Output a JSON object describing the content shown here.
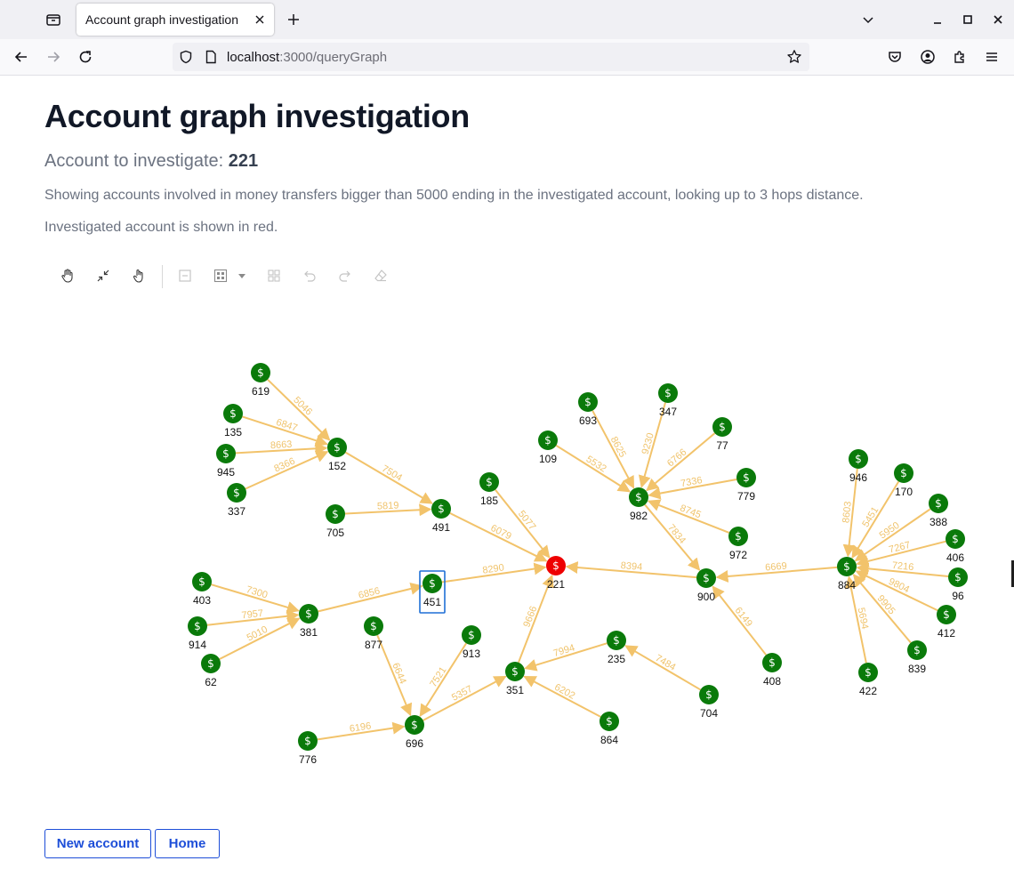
{
  "browser": {
    "tab_title": "Account graph investigation",
    "url_host": "localhost",
    "url_rest": ":3000/queryGraph"
  },
  "page": {
    "title": "Account graph investigation",
    "investigate_label": "Account to investigate:",
    "account_id": "221",
    "description": "Showing accounts involved in money transfers bigger than 5000 ending in the investigated account, looking up to 3 hops distance.",
    "note": "Investigated account is shown in red."
  },
  "toolbar": {
    "icons": [
      "pan-hand-icon",
      "collapse-icon",
      "pointer-hand-icon",
      "minus-box-icon",
      "grid-layout-icon",
      "dropdown-caret-icon",
      "tiles-icon",
      "undo-icon",
      "redo-icon",
      "eraser-icon"
    ]
  },
  "graph": {
    "node_symbol": "$",
    "colors": {
      "node": "#0a7a0a",
      "investigated": "#ee0000",
      "edge": "#f2c36b",
      "edge_label": "#f0c46e",
      "selection": "#1f6fd6"
    },
    "investigated_id": "221",
    "selected_id": "451",
    "nodes": [
      {
        "id": "619"
      },
      {
        "id": "135"
      },
      {
        "id": "945"
      },
      {
        "id": "337"
      },
      {
        "id": "152"
      },
      {
        "id": "705"
      },
      {
        "id": "491"
      },
      {
        "id": "185"
      },
      {
        "id": "221"
      },
      {
        "id": "451"
      },
      {
        "id": "403"
      },
      {
        "id": "914"
      },
      {
        "id": "62"
      },
      {
        "id": "381"
      },
      {
        "id": "877"
      },
      {
        "id": "913"
      },
      {
        "id": "696"
      },
      {
        "id": "776"
      },
      {
        "id": "351"
      },
      {
        "id": "235"
      },
      {
        "id": "864"
      },
      {
        "id": "704"
      },
      {
        "id": "900"
      },
      {
        "id": "408"
      },
      {
        "id": "693"
      },
      {
        "id": "347"
      },
      {
        "id": "109"
      },
      {
        "id": "77"
      },
      {
        "id": "982"
      },
      {
        "id": "779"
      },
      {
        "id": "972"
      },
      {
        "id": "884"
      },
      {
        "id": "946"
      },
      {
        "id": "170"
      },
      {
        "id": "388"
      },
      {
        "id": "406"
      },
      {
        "id": "96"
      },
      {
        "id": "412"
      },
      {
        "id": "839"
      },
      {
        "id": "422"
      }
    ],
    "edges": [
      {
        "from": "619",
        "to": "152",
        "amount": "5046"
      },
      {
        "from": "135",
        "to": "152",
        "amount": "6847"
      },
      {
        "from": "945",
        "to": "152",
        "amount": "8663"
      },
      {
        "from": "337",
        "to": "152",
        "amount": "8366"
      },
      {
        "from": "152",
        "to": "491",
        "amount": "7504"
      },
      {
        "from": "705",
        "to": "491",
        "amount": "5819"
      },
      {
        "from": "491",
        "to": "221",
        "amount": "6079"
      },
      {
        "from": "185",
        "to": "221",
        "amount": "5077"
      },
      {
        "from": "451",
        "to": "221",
        "amount": "8290"
      },
      {
        "from": "900",
        "to": "221",
        "amount": "8394"
      },
      {
        "from": "351",
        "to": "221",
        "amount": "9666"
      },
      {
        "from": "381",
        "to": "451",
        "amount": "6856"
      },
      {
        "from": "403",
        "to": "381",
        "amount": "7300"
      },
      {
        "from": "914",
        "to": "381",
        "amount": "7957"
      },
      {
        "from": "62",
        "to": "381",
        "amount": "5010"
      },
      {
        "from": "877",
        "to": "696",
        "amount": "6644"
      },
      {
        "from": "913",
        "to": "696",
        "amount": "7521"
      },
      {
        "from": "776",
        "to": "696",
        "amount": "6196"
      },
      {
        "from": "696",
        "to": "351",
        "amount": "5357"
      },
      {
        "from": "235",
        "to": "351",
        "amount": "7994"
      },
      {
        "from": "864",
        "to": "351",
        "amount": "6202"
      },
      {
        "from": "704",
        "to": "235",
        "amount": "7484"
      },
      {
        "from": "408",
        "to": "900",
        "amount": "6149"
      },
      {
        "from": "884",
        "to": "900",
        "amount": "6669"
      },
      {
        "from": "982",
        "to": "900",
        "amount": "7834"
      },
      {
        "from": "693",
        "to": "982",
        "amount": "8625"
      },
      {
        "from": "347",
        "to": "982",
        "amount": "9230"
      },
      {
        "from": "109",
        "to": "982",
        "amount": "5532"
      },
      {
        "from": "77",
        "to": "982",
        "amount": "6766"
      },
      {
        "from": "779",
        "to": "982",
        "amount": "7336"
      },
      {
        "from": "972",
        "to": "982",
        "amount": "8745"
      },
      {
        "from": "946",
        "to": "884",
        "amount": "8603"
      },
      {
        "from": "170",
        "to": "884",
        "amount": "5451"
      },
      {
        "from": "388",
        "to": "884",
        "amount": "5950"
      },
      {
        "from": "406",
        "to": "884",
        "amount": "7267"
      },
      {
        "from": "96",
        "to": "884",
        "amount": "7216"
      },
      {
        "from": "412",
        "to": "884",
        "amount": "9804"
      },
      {
        "from": "839",
        "to": "884",
        "amount": "9905"
      },
      {
        "from": "422",
        "to": "884",
        "amount": "5694"
      }
    ]
  },
  "buttons": {
    "new_account": "New account",
    "home": "Home"
  }
}
